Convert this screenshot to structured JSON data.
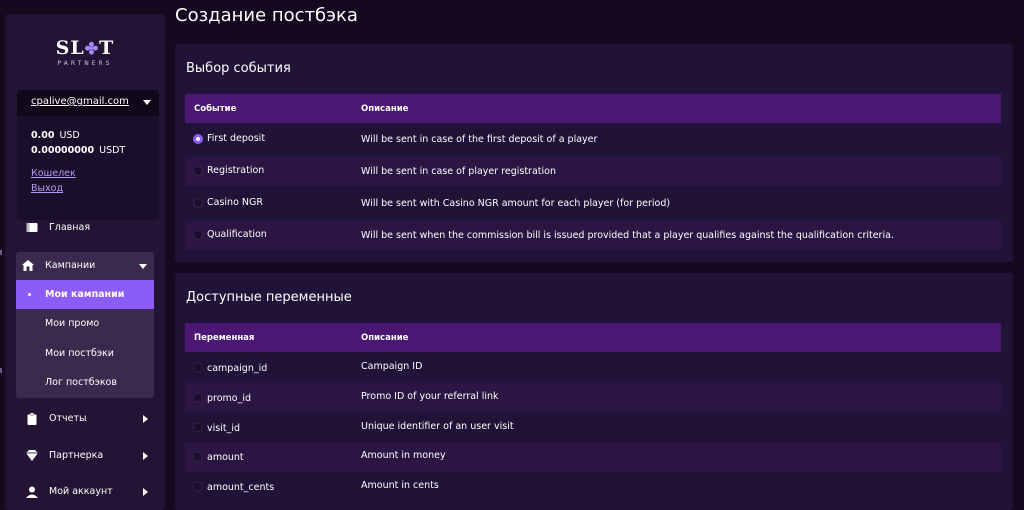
{
  "brand": {
    "logo_main_a": "SL",
    "logo_star": "✤",
    "logo_main_b": "T",
    "logo_sub": "PARTNERS"
  },
  "account": {
    "email": "cpalive@gmail.com",
    "balances": [
      {
        "amount": "0.00",
        "currency": "USD"
      },
      {
        "amount": "0.00000000",
        "currency": "USDT"
      }
    ],
    "wallet_link": "Кошелек",
    "logout_link": "Выход"
  },
  "nav": {
    "home": "Главная",
    "campaigns": "Кампании",
    "campaign_sub": [
      "Мои кампании",
      "Мои промо",
      "Мои постбэки",
      "Лог постбэков"
    ],
    "reports": "Отчеты",
    "partner": "Партнерка",
    "my_account": "Мой аккаунт"
  },
  "page_title": "Создание постбэка",
  "events_card": {
    "title": "Выбор события",
    "columns": [
      "Событие",
      "Описание"
    ],
    "rows": [
      {
        "name": "First deposit",
        "desc": "Will be sent in case of the first deposit of a player",
        "selected": true
      },
      {
        "name": "Registration",
        "desc": "Will be sent in case of player registration",
        "selected": false
      },
      {
        "name": "Casino NGR",
        "desc": "Will be sent with Casino NGR amount for each player (for period)",
        "selected": false
      },
      {
        "name": "Qualification",
        "desc": "Will be sent when the commission bill is issued provided that a player qualifies against the qualification criteria.",
        "selected": false
      }
    ]
  },
  "vars_card": {
    "title": "Доступные переменные",
    "columns": [
      "Переменная",
      "Описание"
    ],
    "rows": [
      {
        "name": "campaign_id",
        "desc": "Campaign ID"
      },
      {
        "name": "promo_id",
        "desc": "Promo ID of your referral link"
      },
      {
        "name": "visit_id",
        "desc": "Unique identifier of an user visit"
      },
      {
        "name": "amount",
        "desc": "Amount in money"
      },
      {
        "name": "amount_cents",
        "desc": "Amount in cents"
      }
    ]
  },
  "colors": {
    "accent": "#8b5cf6",
    "header": "#4a1773",
    "card": "#211238",
    "sidebar": "#231436"
  }
}
